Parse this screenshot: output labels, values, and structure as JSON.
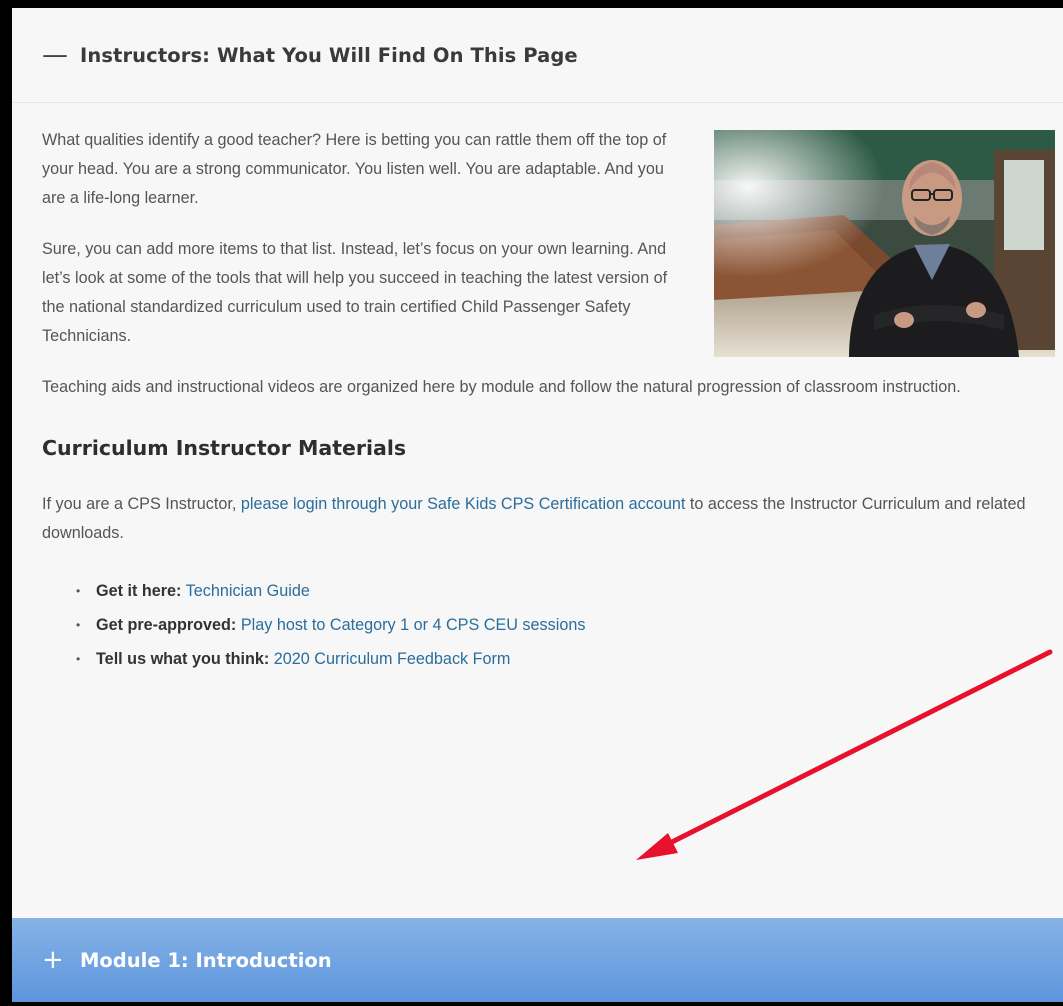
{
  "accordion": {
    "toggle_symbol": "—",
    "title": "Instructors: What You Will Find On This Page"
  },
  "paragraphs": {
    "p1": "What qualities identify a good teacher? Here is betting you can rattle them off the top of your head. You are a strong communicator. You listen well. You are adaptable. And you are a life-long learner.",
    "p2": "Sure, you can add more items to that list. Instead, let’s focus on your own learning. And let’s look at some of the tools that will help you succeed in teaching the latest version of the national standardized curriculum used to train certified Child Passenger Safety Technicians.",
    "p3": "Teaching aids and instructional videos are organized here by module and follow the natural progression of classroom instruction."
  },
  "section_heading": "Curriculum Instructor Materials",
  "cps": {
    "before": "If you are a CPS Instructor, ",
    "link": "please login through your Safe Kids CPS Certification account",
    "after": " to access the Instructor Curriculum and related downloads."
  },
  "list_items": [
    {
      "label": "Get it here:",
      "link": "Technician Guide"
    },
    {
      "label": "Get pre-approved:",
      "link": "Play host to Category 1 or 4 CPS CEU sessions"
    },
    {
      "label": "Tell us what you think:",
      "link": "2020 Curriculum Feedback Form"
    }
  ],
  "module": {
    "toggle_symbol": "+",
    "title": "Module 1: Introduction"
  },
  "colors": {
    "link": "#2b6d9c",
    "module_bar": "#6fa3e0",
    "annotation_arrow": "#e8112d"
  }
}
